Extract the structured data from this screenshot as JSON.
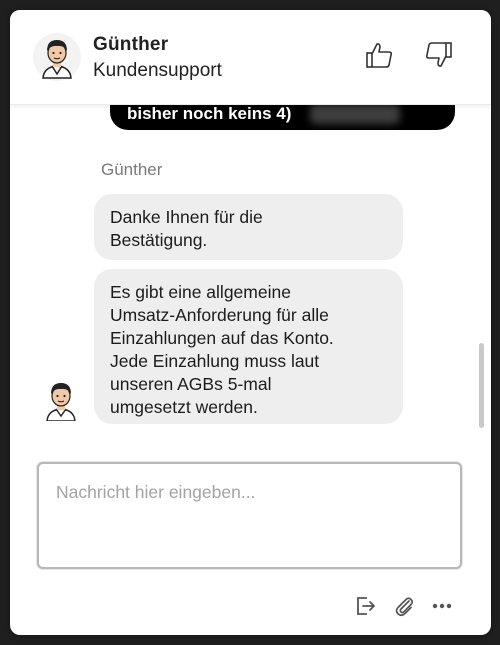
{
  "header": {
    "agent_name": "Günther",
    "agent_role": "Kundensupport",
    "avatar_icon": "agent-avatar-icon",
    "thumbs_up_icon": "thumbs-up-icon",
    "thumbs_down_icon": "thumbs-down-icon"
  },
  "messages": {
    "previous_visitor_message": "bisher noch keins 4)",
    "sender_label": "Günther",
    "agent_messages": [
      "Danke Ihnen für die\nBestätigung.",
      "Es gibt eine allgemeine\nUmsatz-Anforderung für alle\nEinzahlungen auf das Konto.\nJede Einzahlung muss laut\nunseren AGBs 5-mal\numgesetzt werden."
    ]
  },
  "composer": {
    "value": "",
    "placeholder": "Nachricht hier eingeben..."
  },
  "toolbar": {
    "icons": [
      "exit-chat-icon",
      "paperclip-icon",
      "more-options-icon"
    ]
  },
  "colors": {
    "visitor_bubble": "#000000",
    "agent_bubble": "#eeeeef",
    "background": "#ffffff"
  }
}
